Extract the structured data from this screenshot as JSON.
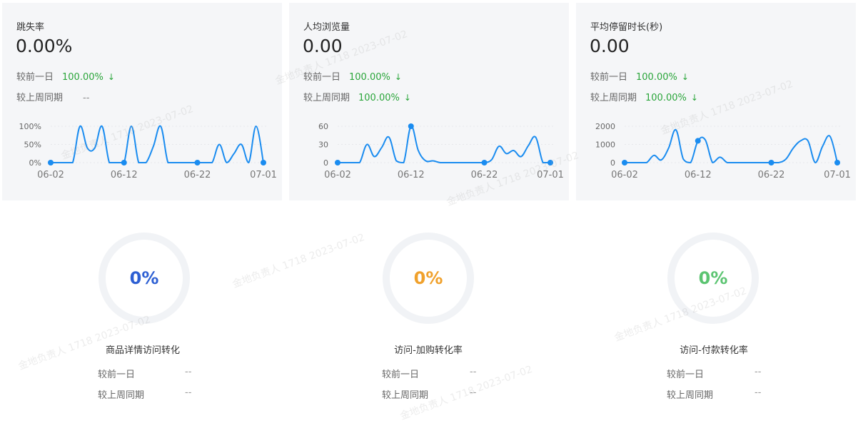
{
  "cards": [
    {
      "title": "跳失率",
      "value": "0.00%",
      "day_label": "较前一日",
      "day_value": "100.00%",
      "week_label": "较上周同期",
      "week_value": "--"
    },
    {
      "title": "人均浏览量",
      "value": "0.00",
      "day_label": "较前一日",
      "day_value": "100.00%",
      "week_label": "较上周同期",
      "week_value": "100.00%"
    },
    {
      "title": "平均停留时长(秒)",
      "value": "0.00",
      "day_label": "较前一日",
      "day_value": "100.00%",
      "week_label": "较上周同期",
      "week_value": "100.00%"
    }
  ],
  "down_arrow": "↓",
  "rings": [
    {
      "pct": "0%",
      "title": "商品详情访问转化",
      "day_label": "较前一日",
      "day_value": "--",
      "week_label": "较上周同期",
      "week_value": "--",
      "color": "#2d5fd3"
    },
    {
      "pct": "0%",
      "title": "访问-加购转化率",
      "day_label": "较前一日",
      "day_value": "--",
      "week_label": "较上周同期",
      "week_value": "--",
      "color": "#f0a12c"
    },
    {
      "pct": "0%",
      "title": "访问-付款转化率",
      "day_label": "较前一日",
      "day_value": "--",
      "week_label": "较上周同期",
      "week_value": "--",
      "color": "#5bc471"
    }
  ],
  "watermark_text": "金地负责人 1718 2023-07-02",
  "colors": {
    "line": "#1a8cf0",
    "up_down_green": "#2aa53a",
    "ring_track": "#f1f3f6"
  },
  "chart_data": [
    {
      "type": "line",
      "title": "跳失率",
      "x_ticks": [
        "06-02",
        "06-12",
        "06-22",
        "07-01"
      ],
      "y_ticks": [
        "0%",
        "50%",
        "100%"
      ],
      "ylim": [
        0,
        100
      ],
      "x": [
        "06-02",
        "06-03",
        "06-04",
        "06-05",
        "06-06",
        "06-07",
        "06-08",
        "06-09",
        "06-10",
        "06-11",
        "06-12",
        "06-13",
        "06-14",
        "06-15",
        "06-16",
        "06-17",
        "06-18",
        "06-19",
        "06-20",
        "06-21",
        "06-22",
        "06-23",
        "06-24",
        "06-25",
        "06-26",
        "06-27",
        "06-28",
        "06-29",
        "06-30",
        "07-01"
      ],
      "values": [
        0,
        0,
        0,
        0,
        100,
        40,
        40,
        100,
        0,
        0,
        0,
        100,
        0,
        0,
        45,
        100,
        0,
        0,
        0,
        0,
        0,
        0,
        0,
        50,
        0,
        25,
        50,
        0,
        100,
        0
      ],
      "markers": [
        "06-02",
        "06-12",
        "06-22",
        "07-01"
      ]
    },
    {
      "type": "line",
      "title": "人均浏览量",
      "x_ticks": [
        "06-02",
        "06-12",
        "06-22",
        "07-01"
      ],
      "y_ticks": [
        "0",
        "30",
        "60"
      ],
      "ylim": [
        0,
        60
      ],
      "x": [
        "06-02",
        "06-03",
        "06-04",
        "06-05",
        "06-06",
        "06-07",
        "06-08",
        "06-09",
        "06-10",
        "06-11",
        "06-12",
        "06-13",
        "06-14",
        "06-15",
        "06-16",
        "06-17",
        "06-18",
        "06-19",
        "06-20",
        "06-21",
        "06-22",
        "06-23",
        "06-24",
        "06-25",
        "06-26",
        "06-27",
        "06-28",
        "06-29",
        "06-30",
        "07-01"
      ],
      "values": [
        0,
        0,
        0,
        0,
        30,
        10,
        25,
        42,
        3,
        0,
        60,
        20,
        3,
        3,
        0,
        0,
        0,
        0,
        0,
        0,
        0,
        5,
        27,
        15,
        20,
        10,
        28,
        42,
        0,
        0
      ],
      "markers": [
        "06-02",
        "06-12",
        "06-22",
        "07-01"
      ]
    },
    {
      "type": "line",
      "title": "平均停留时长(秒)",
      "x_ticks": [
        "06-02",
        "06-12",
        "06-22",
        "07-01"
      ],
      "y_ticks": [
        "0",
        "1000",
        "2000"
      ],
      "ylim": [
        0,
        2000
      ],
      "x": [
        "06-02",
        "06-03",
        "06-04",
        "06-05",
        "06-06",
        "06-07",
        "06-08",
        "06-09",
        "06-10",
        "06-11",
        "06-12",
        "06-13",
        "06-14",
        "06-15",
        "06-16",
        "06-17",
        "06-18",
        "06-19",
        "06-20",
        "06-21",
        "06-22",
        "06-23",
        "06-24",
        "06-25",
        "06-26",
        "06-27",
        "06-28",
        "06-29",
        "06-30",
        "07-01"
      ],
      "values": [
        0,
        0,
        0,
        0,
        400,
        150,
        800,
        1800,
        200,
        0,
        1200,
        1250,
        0,
        300,
        0,
        0,
        0,
        0,
        0,
        0,
        0,
        0,
        200,
        800,
        1200,
        1200,
        0,
        900,
        1450,
        0
      ],
      "markers": [
        "06-02",
        "06-12",
        "06-22",
        "07-01"
      ]
    }
  ]
}
